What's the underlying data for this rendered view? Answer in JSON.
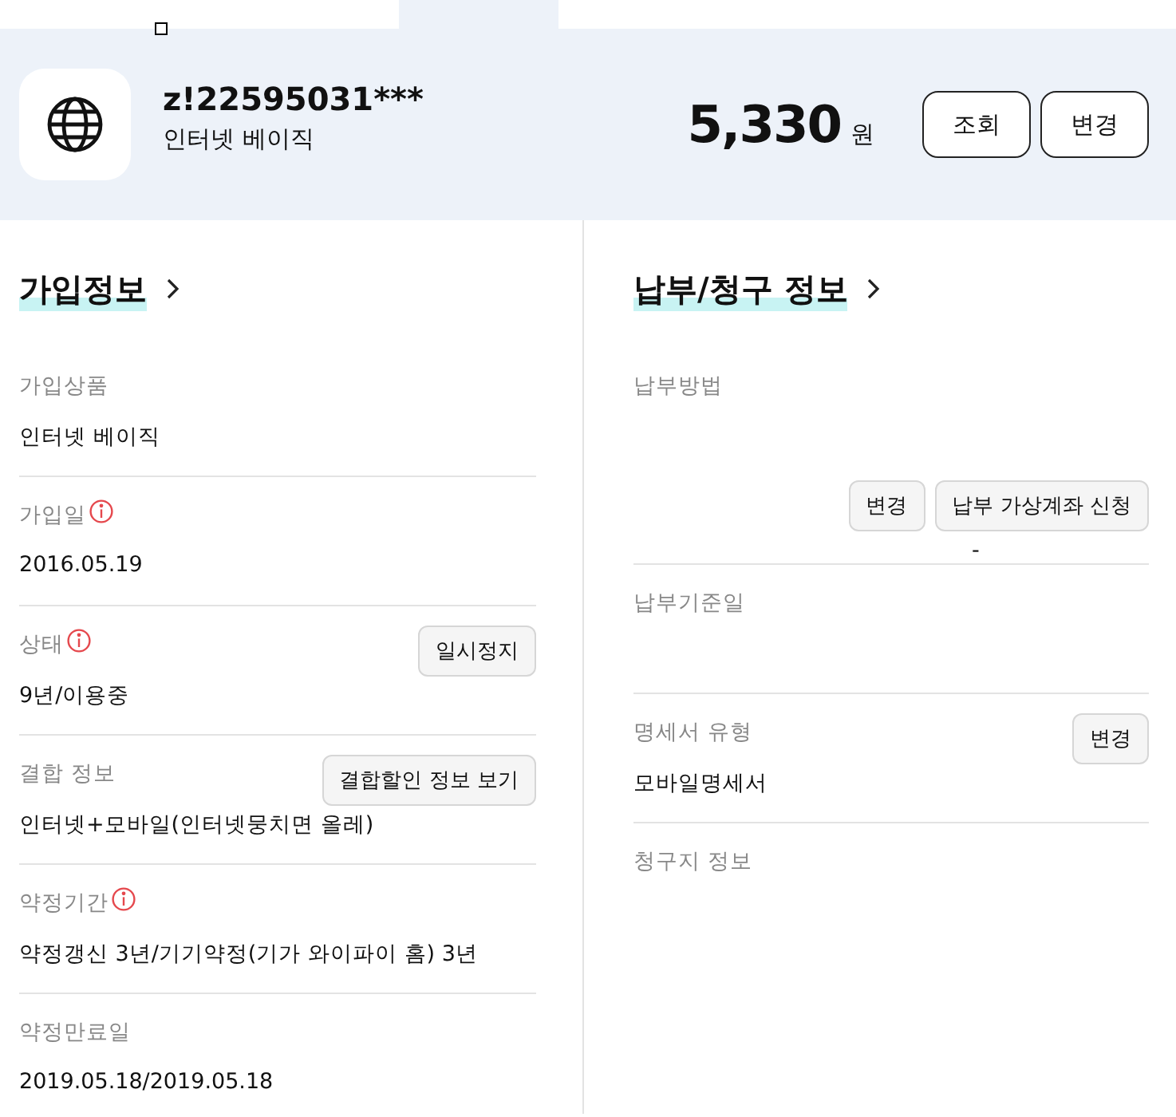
{
  "account": {
    "id": "z!22595031***",
    "product": "인터넷 베이직"
  },
  "fee": {
    "amount": "5,330",
    "unit": "원"
  },
  "header_buttons": [
    "조회",
    "변경"
  ],
  "sections": [
    {
      "title": "가입정보",
      "items": [
        {
          "label": "가입상품",
          "info": false,
          "value": "인터넷 베이직"
        },
        {
          "label": "가입일",
          "info": true,
          "value": "2016.05.19"
        },
        {
          "label": "상태",
          "info": true,
          "value": "9년/이용중",
          "buttons": [
            "일시정지"
          ]
        },
        {
          "label": "결합 정보",
          "info": false,
          "value": "인터넷+모바일(인터넷뭉치면 올레)",
          "buttons": [
            "결합할인 정보 보기"
          ]
        },
        {
          "label": "약정기간",
          "info": true,
          "value": "약정갱신 3년/기기약정(기가 와이파이 홈) 3년"
        },
        {
          "label": "약정만료일",
          "info": false,
          "value": "2019.05.18/2019.05.18"
        }
      ]
    },
    {
      "title": "납부/청구 정보",
      "items": [
        {
          "label": "납부방법",
          "info": false,
          "kind": "below",
          "buttons": [
            "변경",
            "납부 가상계좌 신청"
          ],
          "value": "-"
        },
        {
          "label": "납부기준일",
          "info": false
        },
        {
          "label": "명세서 유형",
          "info": false,
          "value": "모바일명세서",
          "buttons": [
            "변경"
          ]
        },
        {
          "label": "청구지 정보",
          "info": false
        }
      ]
    }
  ]
}
